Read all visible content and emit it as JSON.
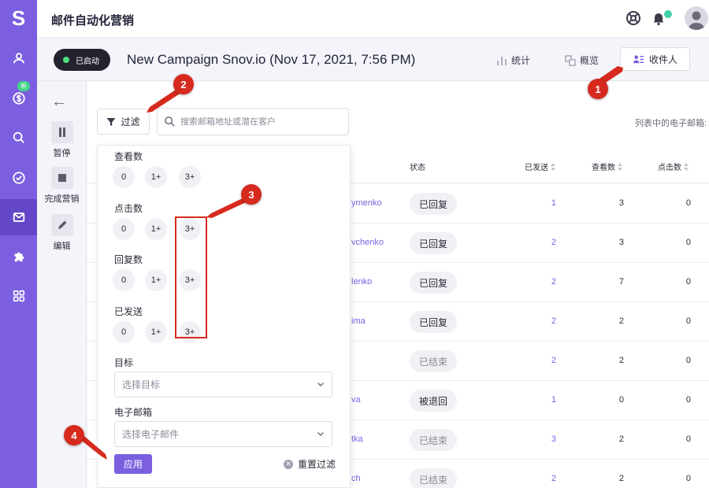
{
  "app": {
    "logo": "S",
    "title": "邮件自动化营销",
    "new_badge": "新"
  },
  "sidebar": {
    "items": [
      {
        "icon": "user-icon"
      },
      {
        "icon": "dollar-icon"
      },
      {
        "icon": "search-icon"
      },
      {
        "icon": "check-circle-icon"
      },
      {
        "icon": "mail-icon",
        "active": true
      },
      {
        "icon": "puzzle-icon"
      },
      {
        "icon": "grid-icon"
      }
    ]
  },
  "topbar": {
    "icons": [
      "support-icon",
      "bell-icon",
      "avatar"
    ]
  },
  "campaign": {
    "status": "已启动",
    "name": "New Campaign Snov.io (Nov 17, 2021, 7:56 PM)",
    "stats_label": "统计",
    "overview_label": "概览",
    "recipients_label": "收件人"
  },
  "actions": {
    "pause": "暂停",
    "complete": "完成营销",
    "edit": "编辑"
  },
  "toolbar": {
    "filter_label": "过滤",
    "search_placeholder": "搜索邮箱地址或潜在客户",
    "list_label": "列表中的电子邮箱:"
  },
  "table": {
    "headers": {
      "status": "状态",
      "sent": "已发送",
      "opened": "查看数",
      "clicked": "点击数"
    },
    "rows": [
      {
        "name": "ymenko",
        "status": "已回复",
        "sent": "1",
        "opened": "3",
        "clicked": "0"
      },
      {
        "name": "vchenko",
        "status": "已回复",
        "sent": "2",
        "opened": "3",
        "clicked": "0"
      },
      {
        "name": "lenko",
        "status": "已回复",
        "sent": "2",
        "opened": "7",
        "clicked": "0"
      },
      {
        "name": "ima",
        "status": "已回复",
        "sent": "2",
        "opened": "2",
        "clicked": "0"
      },
      {
        "name": "",
        "status": "已结束",
        "sent": "2",
        "opened": "2",
        "clicked": "0"
      },
      {
        "name": "va",
        "status": "被退回",
        "sent": "1",
        "opened": "0",
        "clicked": "0"
      },
      {
        "name": "tka",
        "status": "已结束",
        "sent": "3",
        "opened": "2",
        "clicked": "0"
      },
      {
        "name": "ch",
        "status": "已结束",
        "sent": "2",
        "opened": "2",
        "clicked": "0"
      }
    ]
  },
  "filter_panel": {
    "groups": [
      {
        "label": "查看数",
        "options": [
          "0",
          "1+",
          "3+"
        ]
      },
      {
        "label": "点击数",
        "options": [
          "0",
          "1+",
          "3+"
        ]
      },
      {
        "label": "回复数",
        "options": [
          "0",
          "1+",
          "3+"
        ]
      },
      {
        "label": "已发送",
        "options": [
          "0",
          "1+",
          "3+"
        ]
      }
    ],
    "goal_label": "目标",
    "goal_placeholder": "选择目标",
    "email_label": "电子邮箱",
    "email_placeholder": "选择电子邮件",
    "apply_label": "应用",
    "reset_label": "重置过滤"
  },
  "annotations": {
    "callouts": [
      "1",
      "2",
      "3",
      "4"
    ],
    "accent": "#d62a1e"
  },
  "colors": {
    "brand": "#7b5fe0",
    "status_running": "#4ee07a"
  }
}
